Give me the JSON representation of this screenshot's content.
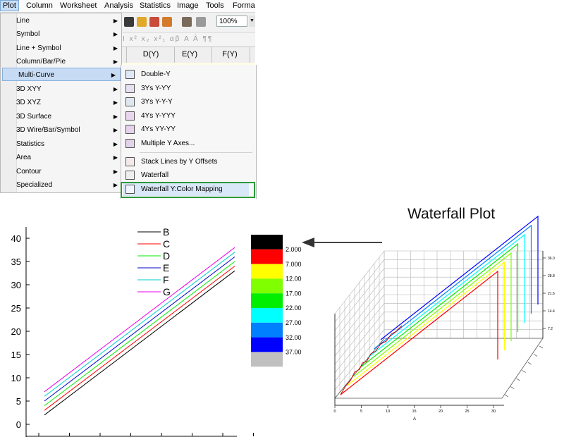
{
  "menubar": {
    "items": [
      "Plot",
      "Column",
      "Worksheet",
      "Analysis",
      "Statistics",
      "Image",
      "Tools",
      "Forma"
    ]
  },
  "toolbar": {
    "zoom": "100%",
    "format_row": "I x² x₂ x²₁ αβ A Ā ¶¶"
  },
  "sheet": {
    "columns": [
      "D(Y)",
      "E(Y)",
      "F(Y)"
    ]
  },
  "plot_menu": {
    "items": [
      "Line",
      "Symbol",
      "Line + Symbol",
      "Column/Bar/Pie",
      "Multi-Curve",
      "3D XYY",
      "3D XYZ",
      "3D Surface",
      "3D Wire/Bar/Symbol",
      "Statistics",
      "Area",
      "Contour",
      "Specialized"
    ],
    "selected": "Multi-Curve"
  },
  "multicurve_menu": {
    "items": [
      "Double-Y",
      "3Ys Y-YY",
      "3Ys Y-Y-Y",
      "4Ys Y-YYY",
      "4Ys YY-YY",
      "Multiple Y Axes...",
      "Stack Lines by Y Offsets",
      "Waterfall",
      "Waterfall Y:Color Mapping"
    ],
    "highlighted": "Waterfall Y:Color Mapping"
  },
  "waterfall_title": "Waterfall Plot",
  "colors": {
    "B": "#000000",
    "C": "#ff0000",
    "D": "#00ee00",
    "E": "#0000cc",
    "F": "#00cccc",
    "G": "#ee00ee",
    "highlight_green": "#2b9a3a",
    "menu_selected": "#c7dcf4"
  },
  "chart_data": [
    {
      "type": "line",
      "title": "",
      "xlabel": "",
      "ylabel": "",
      "ylim": [
        -1,
        42
      ],
      "yticks": [
        "0",
        "5",
        "10",
        "15",
        "20",
        "25",
        "30",
        "35",
        "40"
      ],
      "x": [
        0,
        1
      ],
      "series": [
        {
          "name": "B",
          "values": [
            2,
            33
          ]
        },
        {
          "name": "C",
          "values": [
            3,
            34
          ]
        },
        {
          "name": "D",
          "values": [
            4,
            35
          ]
        },
        {
          "name": "E",
          "values": [
            5,
            36
          ]
        },
        {
          "name": "F",
          "values": [
            6,
            37
          ]
        },
        {
          "name": "G",
          "values": [
            7,
            38
          ]
        }
      ],
      "legend": [
        "B",
        "C",
        "D",
        "E",
        "F",
        "G"
      ],
      "legend_position": "top-right"
    },
    {
      "type": "heatmap",
      "colorbar_levels": [
        "2.000",
        "7.000",
        "12.00",
        "17.00",
        "22.00",
        "27.00",
        "32.00",
        "37.00"
      ],
      "colors": [
        "#000000",
        "#ff0000",
        "#ffff00",
        "#80ff00",
        "#00ee00",
        "#00ffff",
        "#0080ff",
        "#0000ff",
        "#c0c0c0"
      ]
    },
    {
      "type": "line",
      "title": "Waterfall Plot",
      "xlabel": "A",
      "xticks": [
        "0",
        "5",
        "10",
        "15",
        "20",
        "25",
        "30"
      ],
      "zticks": [
        "7.2",
        "14.4",
        "21.6",
        "28.8",
        "36.0"
      ],
      "series_colors": [
        "#ff0000",
        "#ffff00",
        "#80ff00",
        "#00ee00",
        "#00ffff",
        "#0080ff",
        "#0000ff"
      ]
    }
  ]
}
